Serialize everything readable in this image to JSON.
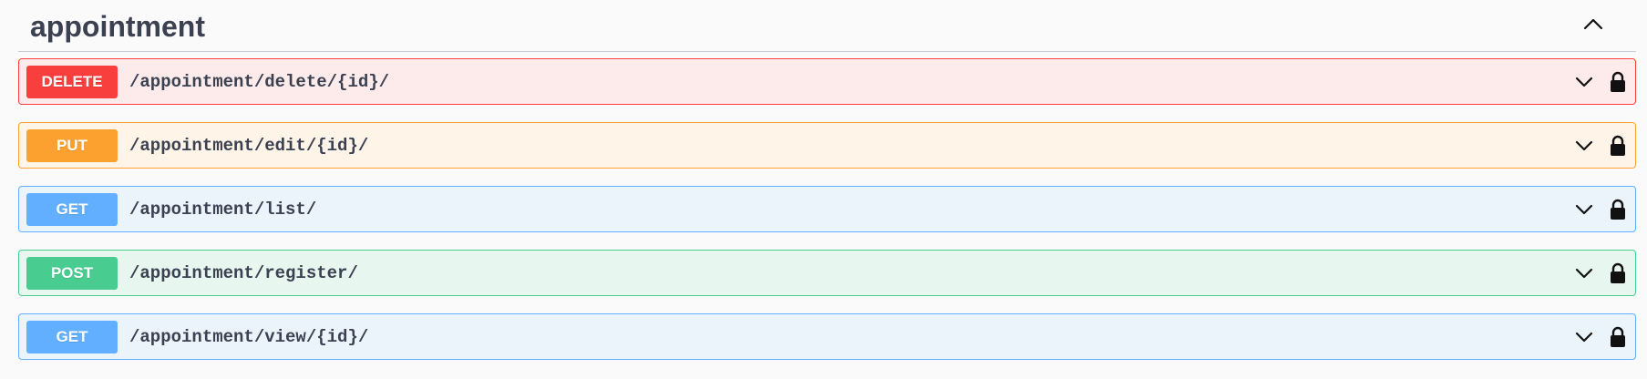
{
  "section": {
    "title": "appointment",
    "collapse_icon": "chevron-up-icon"
  },
  "operations": [
    {
      "method": "DELETE",
      "path": "/appointment/delete/{id}/",
      "colors": {
        "badge": "#f93e3e",
        "border": "#f93e3e",
        "background": "#fcebea"
      }
    },
    {
      "method": "PUT",
      "path": "/appointment/edit/{id}/",
      "colors": {
        "badge": "#fca130",
        "border": "#fca130",
        "background": "#fff4e8"
      }
    },
    {
      "method": "GET",
      "path": "/appointment/list/",
      "colors": {
        "badge": "#61affe",
        "border": "#61affe",
        "background": "#ebf3fb"
      }
    },
    {
      "method": "POST",
      "path": "/appointment/register/",
      "colors": {
        "badge": "#49cc90",
        "border": "#49cc90",
        "background": "#e8f6f0"
      }
    },
    {
      "method": "GET",
      "path": "/appointment/view/{id}/",
      "colors": {
        "badge": "#61affe",
        "border": "#61affe",
        "background": "#ebf3fb"
      }
    }
  ],
  "icons": {
    "expand": "chevron-down-icon",
    "auth": "lock-icon"
  }
}
